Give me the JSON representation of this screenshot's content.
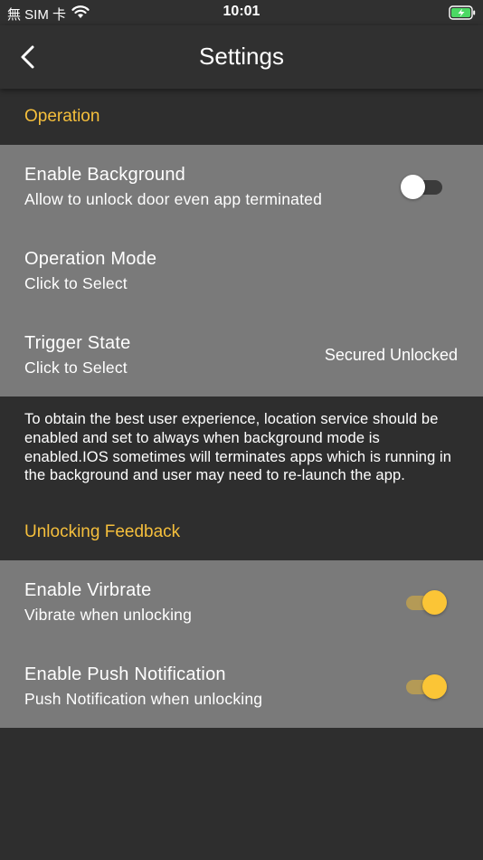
{
  "status_bar": {
    "carrier": "無 SIM 卡",
    "time": "10:01",
    "battery_color": "#4cd964"
  },
  "nav": {
    "title": "Settings"
  },
  "operation": {
    "header": "Operation",
    "rows": [
      {
        "title": "Enable Background",
        "subtitle": "Allow to unlock door even app terminated",
        "toggle": "off"
      },
      {
        "title": "Operation Mode",
        "subtitle": "Click to Select",
        "value": ""
      },
      {
        "title": "Trigger State",
        "subtitle": "Click to Select",
        "value": "Secured Unlocked"
      }
    ],
    "info": "To obtain the best user experience, location service should be enabled and set to always when background mode is enabled.IOS sometimes will terminates apps which is running in the background and user may need to re-launch the app."
  },
  "feedback": {
    "header": "Unlocking Feedback",
    "rows": [
      {
        "title": "Enable Virbrate",
        "subtitle": "Vibrate when unlocking",
        "toggle": "on"
      },
      {
        "title": "Enable Push Notification",
        "subtitle": "Push Notification when unlocking",
        "toggle": "on"
      }
    ]
  },
  "colors": {
    "accent": "#f5bf3c",
    "background": "#2e2e2e",
    "row_background": "#7a7a7a",
    "toggle_on": "#fbc536"
  }
}
